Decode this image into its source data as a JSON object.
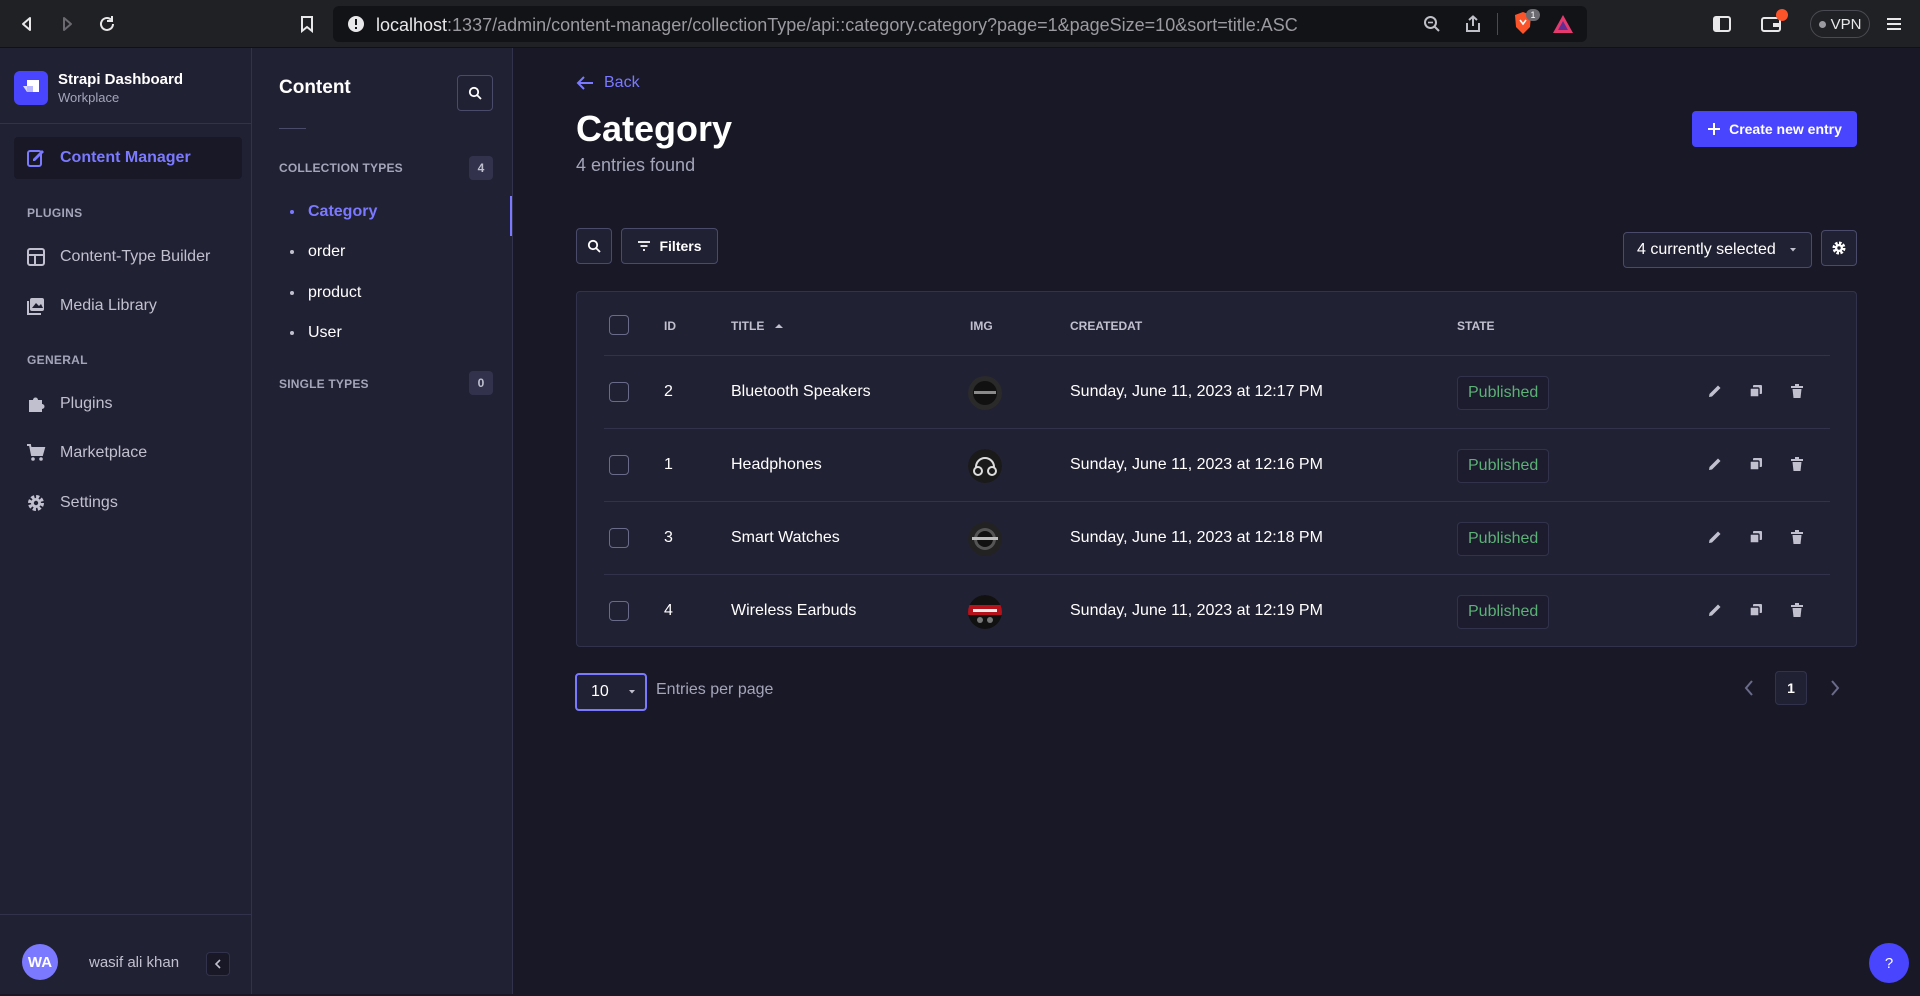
{
  "browser": {
    "url_host": "localhost",
    "url_rest": ":1337/admin/content-manager/collectionType/api::category.category?page=1&pageSize=10&sort=title:ASC",
    "vpn_label": "VPN",
    "brave_badge": "1"
  },
  "brand": {
    "title": "Strapi Dashboard",
    "subtitle": "Workplace"
  },
  "main_nav": {
    "content_manager": "Content Manager",
    "plugins_section": "PLUGINS",
    "content_type_builder": "Content-Type Builder",
    "media_library": "Media Library",
    "general_section": "GENERAL",
    "plugins": "Plugins",
    "marketplace": "Marketplace",
    "settings": "Settings"
  },
  "user": {
    "initials": "WA",
    "name": "wasif ali khan"
  },
  "sub_nav": {
    "title": "Content",
    "collection_types_label": "COLLECTION TYPES",
    "collection_types_count": "4",
    "items": [
      "Category",
      "order",
      "product",
      "User"
    ],
    "single_types_label": "SINGLE TYPES",
    "single_types_count": "0"
  },
  "header": {
    "back_label": "Back",
    "title": "Category",
    "subtitle": "4 entries found",
    "create_label": "Create new entry"
  },
  "toolbar": {
    "filters_label": "Filters",
    "columns_selected": "4 currently selected"
  },
  "table": {
    "headers": {
      "id": "ID",
      "title": "TITLE",
      "img": "IMG",
      "createdat": "CREATEDAT",
      "state": "STATE"
    },
    "rows": [
      {
        "id": "2",
        "title": "Bluetooth Speakers",
        "createdat": "Sunday, June 11, 2023 at 12:17 PM",
        "state": "Published"
      },
      {
        "id": "1",
        "title": "Headphones",
        "createdat": "Sunday, June 11, 2023 at 12:16 PM",
        "state": "Published"
      },
      {
        "id": "3",
        "title": "Smart Watches",
        "createdat": "Sunday, June 11, 2023 at 12:18 PM",
        "state": "Published"
      },
      {
        "id": "4",
        "title": "Wireless Earbuds",
        "createdat": "Sunday, June 11, 2023 at 12:19 PM",
        "state": "Published"
      }
    ]
  },
  "pagination": {
    "page_size": "10",
    "per_page_label": "Entries per page",
    "current_page": "1"
  },
  "help_label": "?",
  "colors": {
    "primary": "#4945ff",
    "accent": "#7b79ff",
    "success": "#5cb176",
    "background": "#181826",
    "surface": "#212134"
  }
}
